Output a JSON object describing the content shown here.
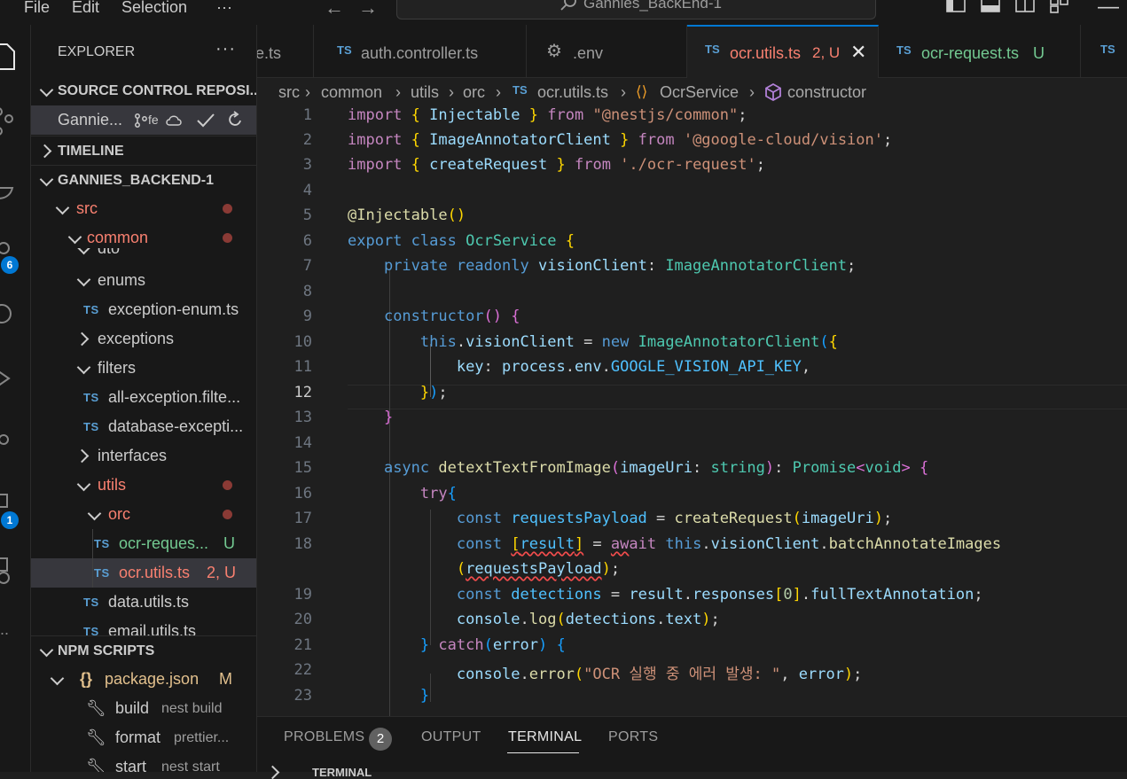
{
  "menu": {
    "file": "File",
    "edit": "Edit",
    "selection": "Selection",
    "more": "···"
  },
  "command_center": {
    "text": "Gannies_BackEnd-1"
  },
  "activity": {
    "badge_accounts": "6",
    "badge_remote": "1"
  },
  "explorer": {
    "title": "EXPLORER",
    "more": "···",
    "sections": {
      "source_control": "SOURCE CONTROL REPOSI...",
      "repo_name": "Gannie...",
      "repo_branch": "fe",
      "timeline": "TIMELINE",
      "project": "GANNIES_BACKEND-1",
      "npm_scripts": "NPM SCRIPTS"
    },
    "tree": {
      "src": "src",
      "common": "common",
      "dto": "dto",
      "enums": "enums",
      "exception_enum": "exception-enum.ts",
      "exceptions": "exceptions",
      "filters": "filters",
      "all_exception": "all-exception.filte...",
      "database_exception": "database-excepti...",
      "interfaces": "interfaces",
      "utils": "utils",
      "orc": "orc",
      "ocr_request": "ocr-reques...",
      "ocr_request_status": "U",
      "ocr_utils": "ocr.utils.ts",
      "ocr_utils_status": "2, U",
      "data_utils": "data.utils.ts",
      "email_utils": "email.utils.ts"
    },
    "ts_label": "TS",
    "npm": {
      "package": "package.json",
      "package_status": "M",
      "package_icon": "{}",
      "scripts": [
        {
          "name": "build",
          "cmd": "nest build"
        },
        {
          "name": "format",
          "cmd": "prettier..."
        },
        {
          "name": "start",
          "cmd": "nest start"
        }
      ]
    }
  },
  "tabs": [
    {
      "label": "e.ts",
      "icon": ""
    },
    {
      "label": "auth.controller.ts",
      "icon": "TS"
    },
    {
      "label": ".env",
      "icon": "gear-icon"
    },
    {
      "label": "ocr.utils.ts",
      "status": "2, U",
      "icon": "TS",
      "active": true
    },
    {
      "label": "ocr-request.ts",
      "status": "U",
      "icon": "TS"
    },
    {
      "label": "",
      "icon": "TS"
    }
  ],
  "breadcrumb": [
    "src",
    "common",
    "utils",
    "orc",
    "ocr.utils.ts",
    "OcrService",
    "constructor"
  ],
  "editor": {
    "line_numbers": [
      "1",
      "2",
      "3",
      "4",
      "5",
      "6",
      "7",
      "8",
      "9",
      "10",
      "11",
      "12",
      "13",
      "14",
      "15",
      "16",
      "17",
      "18",
      "",
      "19",
      "20",
      "21",
      "22",
      "23"
    ],
    "current_line": "12"
  },
  "panel": {
    "tabs": [
      "PROBLEMS",
      "OUTPUT",
      "TERMINAL",
      "PORTS"
    ],
    "problems_count": "2",
    "active": "TERMINAL",
    "terminal_label": "TERMINAL"
  },
  "colors": {
    "accent": "#0078d4",
    "modified_red": "#f88070",
    "untracked_green": "#73c991",
    "modified_yellow": "#e2c08d"
  }
}
